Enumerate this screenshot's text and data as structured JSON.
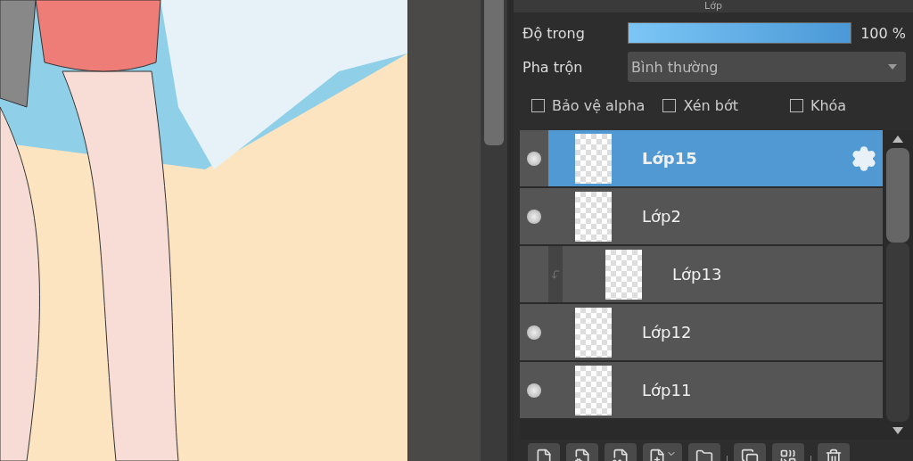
{
  "panel": {
    "title": "Lớp"
  },
  "opacity": {
    "label": "Độ trong",
    "level": 1.0,
    "reading": "100 %"
  },
  "blend": {
    "label": "Pha trộn",
    "value": "Bình thường"
  },
  "options": [
    {
      "label": "Bảo vệ alpha",
      "checked": false
    },
    {
      "label": "Xén bớt",
      "checked": false
    },
    {
      "label": "Khóa",
      "checked": false
    }
  ],
  "layers": [
    {
      "name": "Lớp15",
      "selected": true,
      "visible": true,
      "clipped": false
    },
    {
      "name": "Lớp2",
      "selected": false,
      "visible": true,
      "clipped": false
    },
    {
      "name": "Lớp13",
      "selected": false,
      "visible": false,
      "clipped": true
    },
    {
      "name": "Lớp12",
      "selected": false,
      "visible": true,
      "clipped": false
    },
    {
      "name": "Lớp11",
      "selected": false,
      "visible": true,
      "clipped": false
    }
  ],
  "toolbar": [
    {
      "kind": "new"
    },
    {
      "kind": "settings"
    },
    {
      "kind": "number"
    },
    {
      "kind": "dropdown"
    },
    {
      "kind": "folder"
    },
    {
      "kind": "sep"
    },
    {
      "kind": "copy"
    },
    {
      "kind": "merge"
    },
    {
      "kind": "sep"
    },
    {
      "kind": "delete"
    }
  ]
}
